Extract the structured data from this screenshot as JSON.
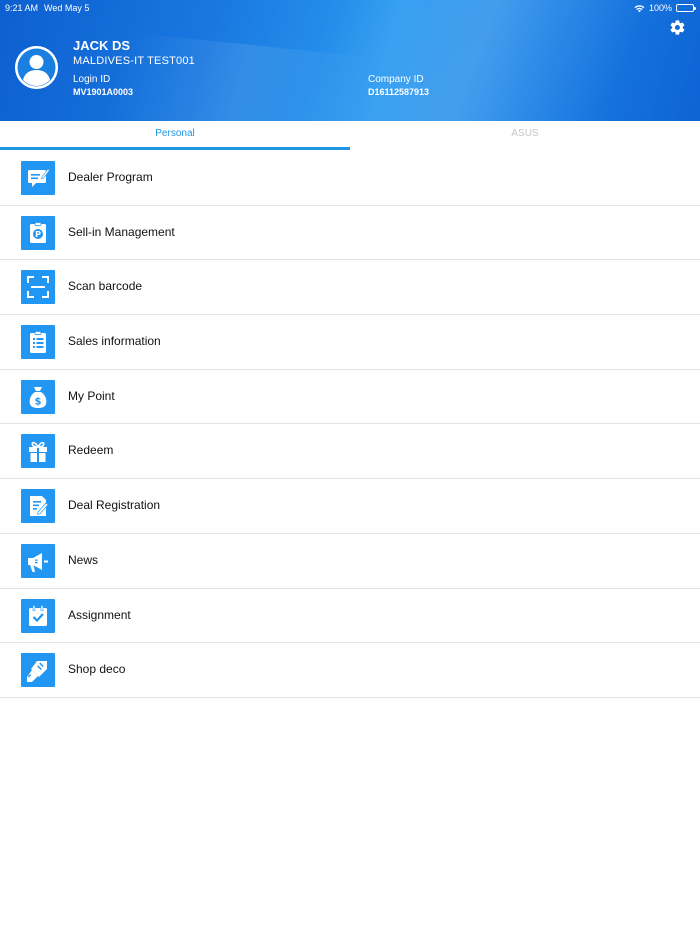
{
  "status_bar": {
    "time": "9:21 AM",
    "date": "Wed May 5",
    "battery": "100%"
  },
  "profile": {
    "name": "JACK DS",
    "company": "MALDIVES-IT TEST001",
    "login_label": "Login ID",
    "login_value": "MV1901A0003",
    "company_label": "Company ID",
    "company_value": "D16112587913"
  },
  "tabs": [
    {
      "label": "Personal",
      "active": true
    },
    {
      "label": "ASUS",
      "active": false
    }
  ],
  "menu": [
    {
      "label": "Dealer Program",
      "icon": "dealer-program-icon"
    },
    {
      "label": "Sell-in Management",
      "icon": "sell-in-management-icon"
    },
    {
      "label": "Scan barcode",
      "icon": "scan-barcode-icon"
    },
    {
      "label": "Sales information",
      "icon": "sales-information-icon"
    },
    {
      "label": "My Point",
      "icon": "money-bag-icon"
    },
    {
      "label": "Redeem",
      "icon": "gift-icon"
    },
    {
      "label": "Deal Registration",
      "icon": "deal-registration-icon"
    },
    {
      "label": "News",
      "icon": "megaphone-icon"
    },
    {
      "label": "Assignment",
      "icon": "assignment-icon"
    },
    {
      "label": "Shop deco",
      "icon": "paint-brush-icon"
    }
  ],
  "colors": {
    "accent": "#1e96e0",
    "icon_bg": "#2196f3",
    "header": "#1978e0"
  }
}
